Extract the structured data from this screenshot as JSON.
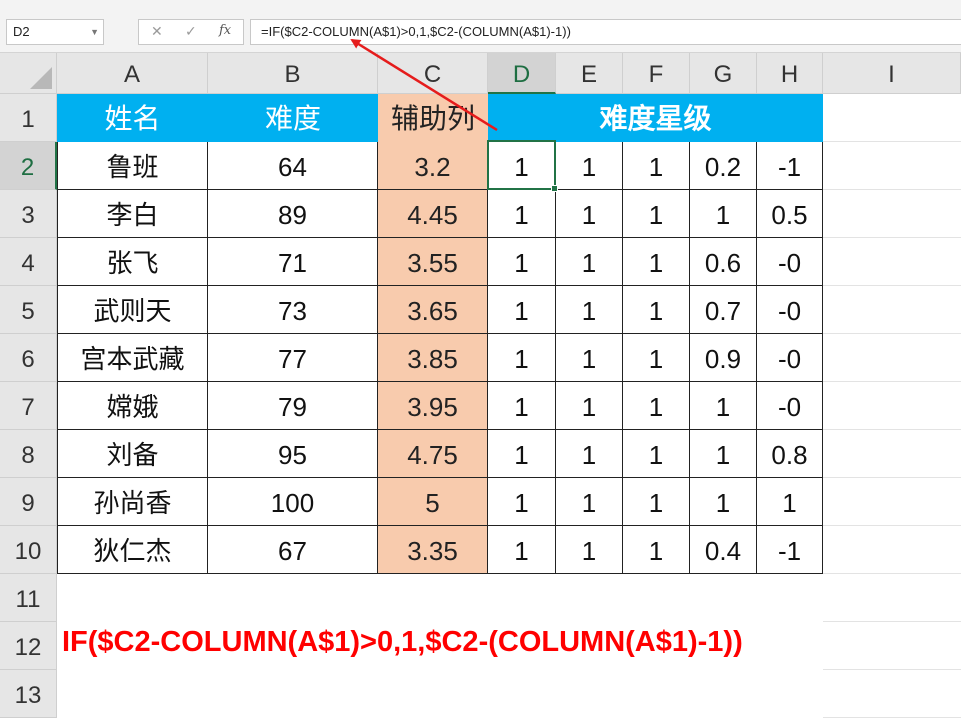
{
  "name_box": "D2",
  "formula_bar": {
    "cancel_glyph": "✕",
    "enter_glyph": "✓",
    "fx_label": "fx",
    "formula": "=IF($C2-COLUMN(A$1)>0,1,$C2-(COLUMN(A$1)-1))"
  },
  "columns": [
    "A",
    "B",
    "C",
    "D",
    "E",
    "F",
    "G",
    "H",
    "I"
  ],
  "rows": [
    "1",
    "2",
    "3",
    "4",
    "5",
    "6",
    "7",
    "8",
    "9",
    "10",
    "11",
    "12",
    "13"
  ],
  "selected": {
    "column": "D",
    "row": "2"
  },
  "headers": {
    "name": "姓名",
    "difficulty": "难度",
    "helper": "辅助列",
    "stars": "难度星级"
  },
  "table": [
    {
      "name": "鲁班",
      "difficulty": "64",
      "helper": "3.2",
      "stars": [
        "1",
        "1",
        "1",
        "0.2",
        "-1"
      ]
    },
    {
      "name": "李白",
      "difficulty": "89",
      "helper": "4.45",
      "stars": [
        "1",
        "1",
        "1",
        "1",
        "0.5"
      ]
    },
    {
      "name": "张飞",
      "difficulty": "71",
      "helper": "3.55",
      "stars": [
        "1",
        "1",
        "1",
        "0.6",
        "-0"
      ]
    },
    {
      "name": "武则天",
      "difficulty": "73",
      "helper": "3.65",
      "stars": [
        "1",
        "1",
        "1",
        "0.7",
        "-0"
      ]
    },
    {
      "name": "宫本武藏",
      "difficulty": "77",
      "helper": "3.85",
      "stars": [
        "1",
        "1",
        "1",
        "0.9",
        "-0"
      ]
    },
    {
      "name": "嫦娥",
      "difficulty": "79",
      "helper": "3.95",
      "stars": [
        "1",
        "1",
        "1",
        "1",
        "-0"
      ]
    },
    {
      "name": "刘备",
      "difficulty": "95",
      "helper": "4.75",
      "stars": [
        "1",
        "1",
        "1",
        "1",
        "0.8"
      ]
    },
    {
      "name": "孙尚香",
      "difficulty": "100",
      "helper": "5",
      "stars": [
        "1",
        "1",
        "1",
        "1",
        "1"
      ]
    },
    {
      "name": "狄仁杰",
      "difficulty": "67",
      "helper": "3.35",
      "stars": [
        "1",
        "1",
        "1",
        "0.4",
        "-1"
      ]
    }
  ],
  "annotation_formula": "IF($C2-COLUMN(A$1)>0,1,$C2-(COLUMN(A$1)-1))",
  "colors": {
    "header_blue": "#00b0f0",
    "helper_fill": "#f8cbad",
    "annotation_red": "#ff0000",
    "selection_green": "#217346"
  }
}
